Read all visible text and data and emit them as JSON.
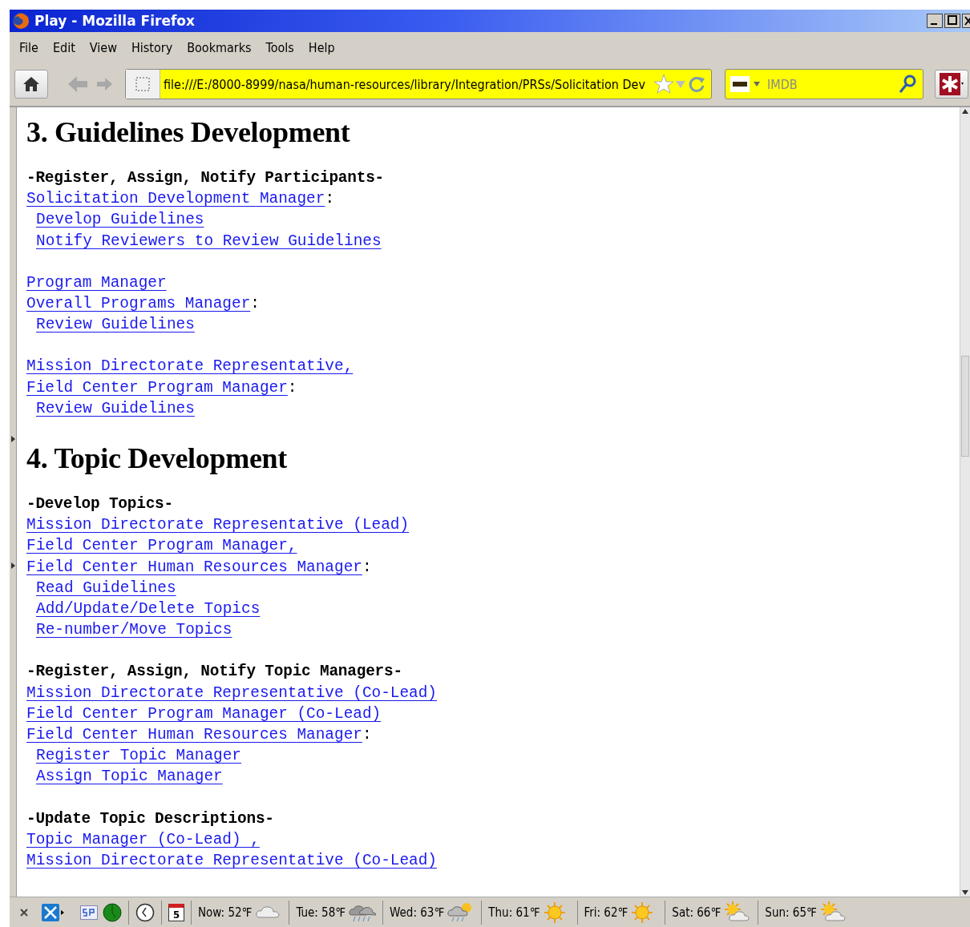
{
  "window": {
    "title": "Play - Mozilla Firefox"
  },
  "menu": [
    "File",
    "Edit",
    "View",
    "History",
    "Bookmarks",
    "Tools",
    "Help"
  ],
  "address_bar": {
    "value": "file:///E:/8000-8999/nasa/human-resources/library/Integration/PRSs/Solicitation Dev"
  },
  "search": {
    "placeholder": "IMDB"
  },
  "sections": [
    {
      "heading": "3. Guidelines Development",
      "blocks": [
        [
          {
            "kind": "label",
            "text": "-Register, Assign, Notify Participants-"
          },
          {
            "kind": "link",
            "text": "Solicitation Development Manager",
            "suffix": ":"
          },
          {
            "kind": "sublink",
            "text": "Develop Guidelines"
          },
          {
            "kind": "sublink",
            "text": "Notify Reviewers to Review Guidelines"
          }
        ],
        [
          {
            "kind": "link",
            "text": "Program Manager"
          },
          {
            "kind": "link",
            "text": "Overall Programs Manager",
            "suffix": ":"
          },
          {
            "kind": "sublink",
            "text": "Review Guidelines"
          }
        ],
        [
          {
            "kind": "link",
            "text": "Mission Directorate Representative,"
          },
          {
            "kind": "link",
            "text": "Field Center Program Manager",
            "suffix": ":"
          },
          {
            "kind": "sublink",
            "text": "Review Guidelines"
          }
        ]
      ]
    },
    {
      "heading": "4. Topic Development",
      "blocks": [
        [
          {
            "kind": "label",
            "text": "-Develop Topics-"
          },
          {
            "kind": "link",
            "text": "Mission Directorate Representative (Lead)"
          },
          {
            "kind": "link",
            "text": "Field Center Program Manager,"
          },
          {
            "kind": "link",
            "text": "Field Center Human Resources Manager",
            "suffix": ":"
          },
          {
            "kind": "sublink",
            "text": "Read Guidelines"
          },
          {
            "kind": "sublink",
            "text": "Add/Update/Delete Topics"
          },
          {
            "kind": "sublink",
            "text": "Re-number/Move Topics"
          }
        ],
        [
          {
            "kind": "label",
            "text": "-Register, Assign, Notify Topic Managers-"
          },
          {
            "kind": "link",
            "text": "Mission Directorate Representative (Co-Lead)"
          },
          {
            "kind": "link",
            "text": "Field Center Program Manager (Co-Lead)"
          },
          {
            "kind": "link",
            "text": "Field Center Human Resources Manager",
            "suffix": ":"
          },
          {
            "kind": "sublink",
            "text": "Register Topic Manager"
          },
          {
            "kind": "sublink",
            "text": "Assign Topic Manager"
          }
        ],
        [
          {
            "kind": "label",
            "text": "-Update Topic Descriptions-"
          },
          {
            "kind": "link",
            "text": "Topic Manager (Co-Lead) ,"
          },
          {
            "kind": "link",
            "text": "Mission Directorate Representative (Co-Lead)"
          }
        ]
      ]
    }
  ],
  "status_bar": {
    "calendar_day": "5",
    "weather": [
      {
        "text": "Now: 52℉",
        "kind": "cloud"
      },
      {
        "text": "Tue: 58℉",
        "kind": "rain"
      },
      {
        "text": "Wed: 63℉",
        "kind": "partly-rain"
      },
      {
        "text": "Thu: 61℉",
        "kind": "sun"
      },
      {
        "text": "Fri: 62℉",
        "kind": "sun"
      },
      {
        "text": "Sat: 66℉",
        "kind": "partly"
      },
      {
        "text": "Sun: 65℉",
        "kind": "partly"
      }
    ]
  }
}
